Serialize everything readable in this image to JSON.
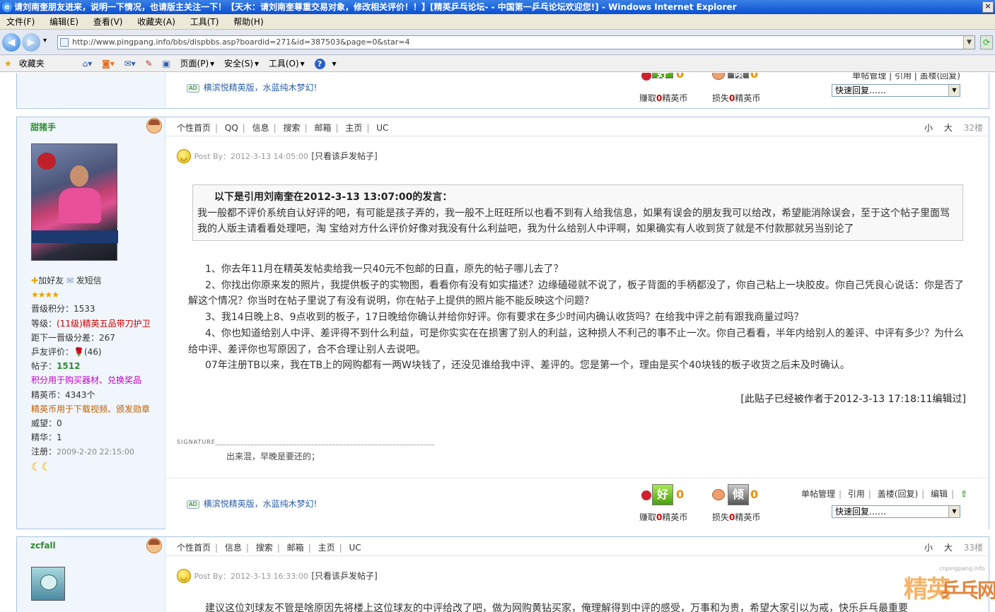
{
  "window": {
    "title": "请刘南奎朋友进来，说明一下情况，也请版主关注一下！【天木：请刘南奎尊重交易对象，修改相关评价！！】[精英乒乓论坛- - 中国第一乒乓论坛欢迎您!] - Windows Internet Explorer",
    "close": "×"
  },
  "menu": [
    "文件(F)",
    "编辑(E)",
    "查看(V)",
    "收藏夹(A)",
    "工具(T)",
    "帮助(H)"
  ],
  "nav": {
    "back": "◀",
    "forward": "▶",
    "dropdown": "▾",
    "url": "http://www.pingpang.info/bbs/dispbbs.asp?boardid=271&id=387503&page=0&star=4",
    "refresh": "⟳"
  },
  "favbar": {
    "favorites": "收藏夹",
    "page": "页面(P)",
    "safety": "安全(S)",
    "tools": "工具(O)",
    "help": "?"
  },
  "prev_footer": {
    "ad": "横滨悦精英版，水蓝纯木梦幻!",
    "good_zero": "0",
    "bad_zero": "0",
    "earn_label_a": "赚取",
    "earn_num": "0",
    "earn_label_b": "精英币",
    "lose_label_a": "损失",
    "lose_num": "0",
    "lose_label_b": "精英币",
    "manage": "单帖管理 | 引用 | 盖楼(回复)",
    "quick_reply": "快速回复……"
  },
  "post1": {
    "username": "甜猪手",
    "links": [
      "个性首页",
      "QQ",
      "信息",
      "搜索",
      "邮箱",
      "主页",
      "UC"
    ],
    "size_small": "小",
    "size_large": "大",
    "floor": "32楼",
    "add_friend": "加好友",
    "send_msg": "发短信",
    "stars": "★★★★",
    "info": {
      "score_label": "晋级积分：",
      "score": "1533",
      "level_label": "等级：",
      "level": "(11级)精英五品带刀护卫",
      "next_label": "距下一晋级分差：",
      "next": "267",
      "rating_label": "乒友评价：",
      "rating": "(46)",
      "posts_label": "帖子：",
      "posts": "1512",
      "points_note": "积分用于购买器材、兑换奖品",
      "coins_label": "精英币：",
      "coins": "4343个",
      "coins_note": "精英币用于下载视频、颁发勋章",
      "prestige_label": "威望：",
      "prestige": "0",
      "elite_label": "精华：",
      "elite": "1",
      "reg_label": "注册：",
      "reg": "2009-2-20 22:15:00"
    },
    "moons": "☾☾",
    "post_by": "Post By：2012-3-13 14:05:00",
    "only_view": "[只看该乒发帖子]",
    "quote_head": "以下是引用刘南奎在2012-3-13 13:07:00的发言：",
    "quote_body": "我一般都不评价系统自认好评的吧，有可能是孩子弄的，我一般不上旺旺所以也看不到有人给我信息，如果有误会的朋友我可以给改，希望能消除误会，至于这个帖子里面骂我的人版主请看看处理吧，淘  宝给对方什么评价好像对我没有什么利益吧，我为什么给别人中评啊，如果确实有人收到货了就是不付款那就另当别论了",
    "p1": "1、你去年11月在精英发帖卖给我一只40元不包邮的日直，原先的帖子哪儿去了？",
    "p2": "2、你找出你原来发的照片，我提供板子的实物图，看看你有没有如实描述？边缘磕碰就不说了，板子背面的手柄都没了，你自己粘上一块胶皮。你自己凭良心说话：你是否了解这个情况？你当时在帖子里说了有没有说明，你在帖子上提供的照片能不能反映这个问题？",
    "p3": "3、我14日晚上8、9点收到的板子，17日晚给你确认并给你好评。你有要求在多少时间内确认收货吗？在给我中评之前有跟我商量过吗？",
    "p4": "4、你也知道给别人中评、差评得不到什么利益，可是你实实在在损害了别人的利益，这种损人不利己的事不止一次。你自己看看，半年内给别人的差评、中评有多少？为什么给中评、差评你也写原因了，合不合理让别人去说吧。",
    "p5": "07年注册TB以来，我在TB上的网购都有一两W块钱了，还没见谁给我中评、差评的。您是第一个，理由是买个40块钱的板子收货之后未及时确认。",
    "edited": "[此贴子已经被作者于2012-3-13 17:18:11编辑过]",
    "signature_label": "SIGNATURE",
    "signature": "出来混，早晚是要还的；",
    "ad": "横滨悦精英版，水蓝纯木梦幻!",
    "good_zero": "0",
    "bad_zero": "0",
    "good_text": "好",
    "bad_text": "倾",
    "earn_label_a": "赚取",
    "earn_num": "0",
    "earn_label_b": "精英币",
    "lose_label_a": "损失",
    "lose_num": "0",
    "lose_label_b": "精英币",
    "m1": "单帖管理",
    "m2": "引用",
    "m3": "盖楼(回复)",
    "m4": "编辑",
    "up": "⇧",
    "quick_reply": "快速回复……"
  },
  "post2": {
    "username": "zcfall",
    "links": [
      "个性首页",
      "信息",
      "搜索",
      "邮箱",
      "主页",
      "UC"
    ],
    "size_small": "小",
    "size_large": "大",
    "floor": "33楼",
    "post_by": "Post By：2012-3-13 16:33:00",
    "only_view": "[只看该乒发帖子]",
    "p1": "建议这位刘球友不管是啥原因先将楼上这位球友的中评给改了吧，做为网购黄钻买家，俺理解得到中评的感受，万事和为贵，希望大家引以为戒，快乐乒乓最重要"
  },
  "watermark": {
    "site": "cnpingpang.info",
    "t1": "精英",
    "t2": "乒乓网"
  }
}
